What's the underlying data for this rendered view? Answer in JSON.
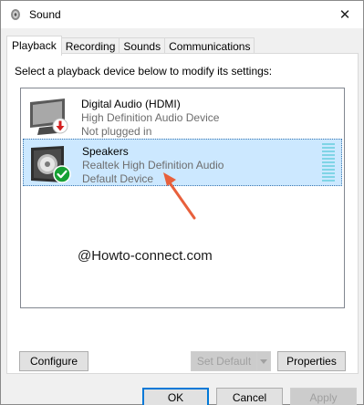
{
  "window": {
    "title": "Sound",
    "close_label": "✕"
  },
  "tabs": [
    {
      "label": "Playback",
      "active": true
    },
    {
      "label": "Recording",
      "active": false
    },
    {
      "label": "Sounds",
      "active": false
    },
    {
      "label": "Communications",
      "active": false
    }
  ],
  "instruction": "Select a playback device below to modify its settings:",
  "devices": [
    {
      "name": "Digital Audio (HDMI)",
      "description": "High Definition Audio Device",
      "status": "Not plugged in",
      "icon": "monitor-icon",
      "badge": "red-down-arrow-badge"
    },
    {
      "name": "Speakers",
      "description": "Realtek High Definition Audio",
      "status": "Default Device",
      "icon": "speaker-icon",
      "badge": "green-check-badge",
      "selected": true
    }
  ],
  "watermark": "@Howto-connect.com",
  "buttons": {
    "configure": "Configure",
    "set_default": "Set Default",
    "properties": "Properties",
    "ok": "OK",
    "cancel": "Cancel",
    "apply": "Apply"
  },
  "colors": {
    "selection": "#cce8ff",
    "annotation_arrow": "#e8603c",
    "level_meter": "#7fd4e6"
  }
}
